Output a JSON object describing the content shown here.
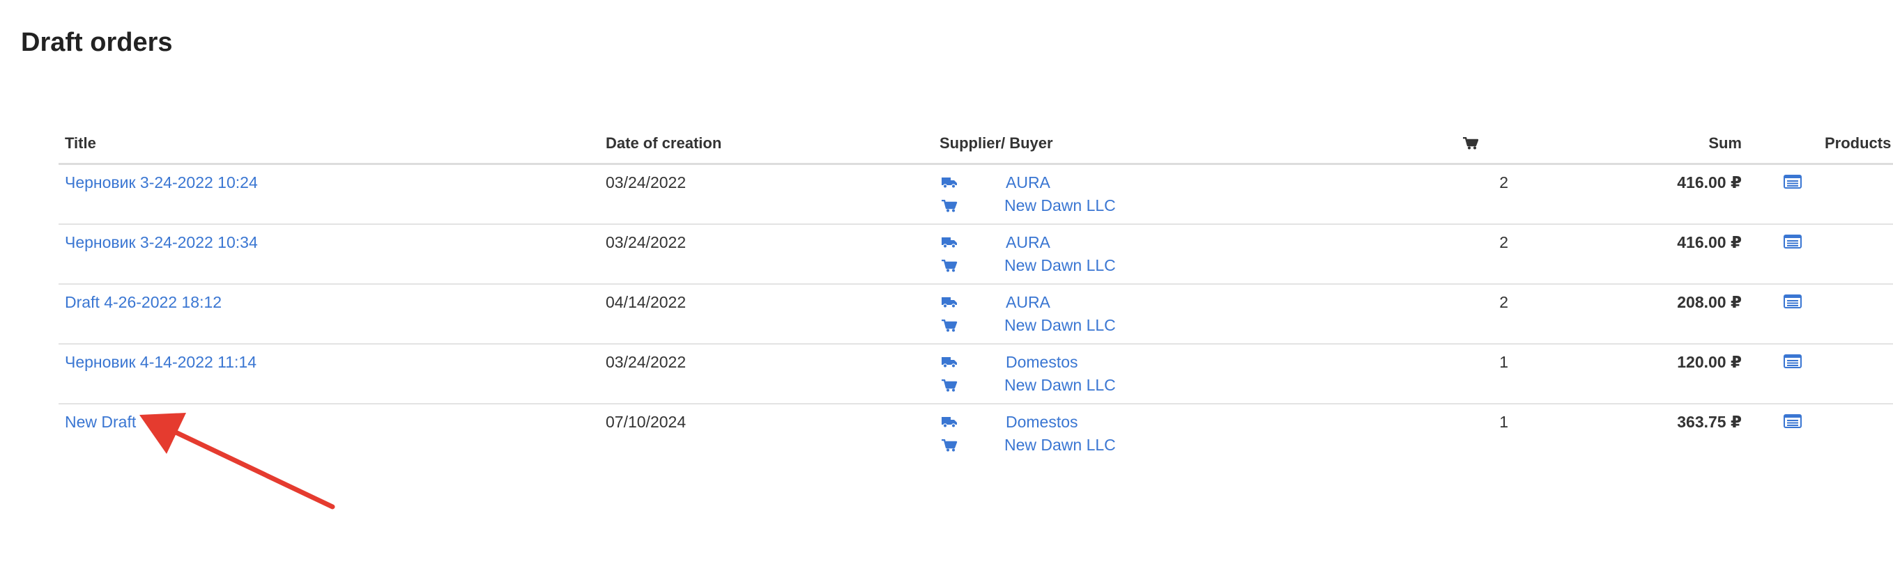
{
  "page": {
    "title": "Draft orders"
  },
  "table": {
    "headers": {
      "title": "Title",
      "date": "Date of creation",
      "party": "Supplier/ Buyer",
      "quantity_icon": "cart-icon",
      "sum": "Sum",
      "products": "Products"
    },
    "rows": [
      {
        "title": "Черновик 3-24-2022 10:24",
        "date": "03/24/2022",
        "supplier": "AURA",
        "buyer": "New Dawn LLC",
        "quantity": "2",
        "sum": "416.00 ₽"
      },
      {
        "title": "Черновик 3-24-2022 10:34",
        "date": "03/24/2022",
        "supplier": "AURA",
        "buyer": "New Dawn LLC",
        "quantity": "2",
        "sum": "416.00 ₽"
      },
      {
        "title": "Draft 4-26-2022 18:12",
        "date": "04/14/2022",
        "supplier": "AURA",
        "buyer": "New Dawn LLC",
        "quantity": "2",
        "sum": "208.00 ₽"
      },
      {
        "title": "Черновик 4-14-2022 11:14",
        "date": "03/24/2022",
        "supplier": "Domestos",
        "buyer": "New Dawn LLC",
        "quantity": "1",
        "sum": "120.00 ₽"
      },
      {
        "title": "New Draft",
        "date": "07/10/2024",
        "supplier": "Domestos",
        "buyer": "New Dawn LLC",
        "quantity": "1",
        "sum": "363.75 ₽"
      }
    ]
  },
  "icons": {
    "supplier": "truck-icon",
    "buyer": "cart-icon",
    "products": "list-icon"
  },
  "colors": {
    "link": "#3a76d2",
    "icon": "#3a76d2",
    "annotation_arrow": "#e53b2f"
  }
}
